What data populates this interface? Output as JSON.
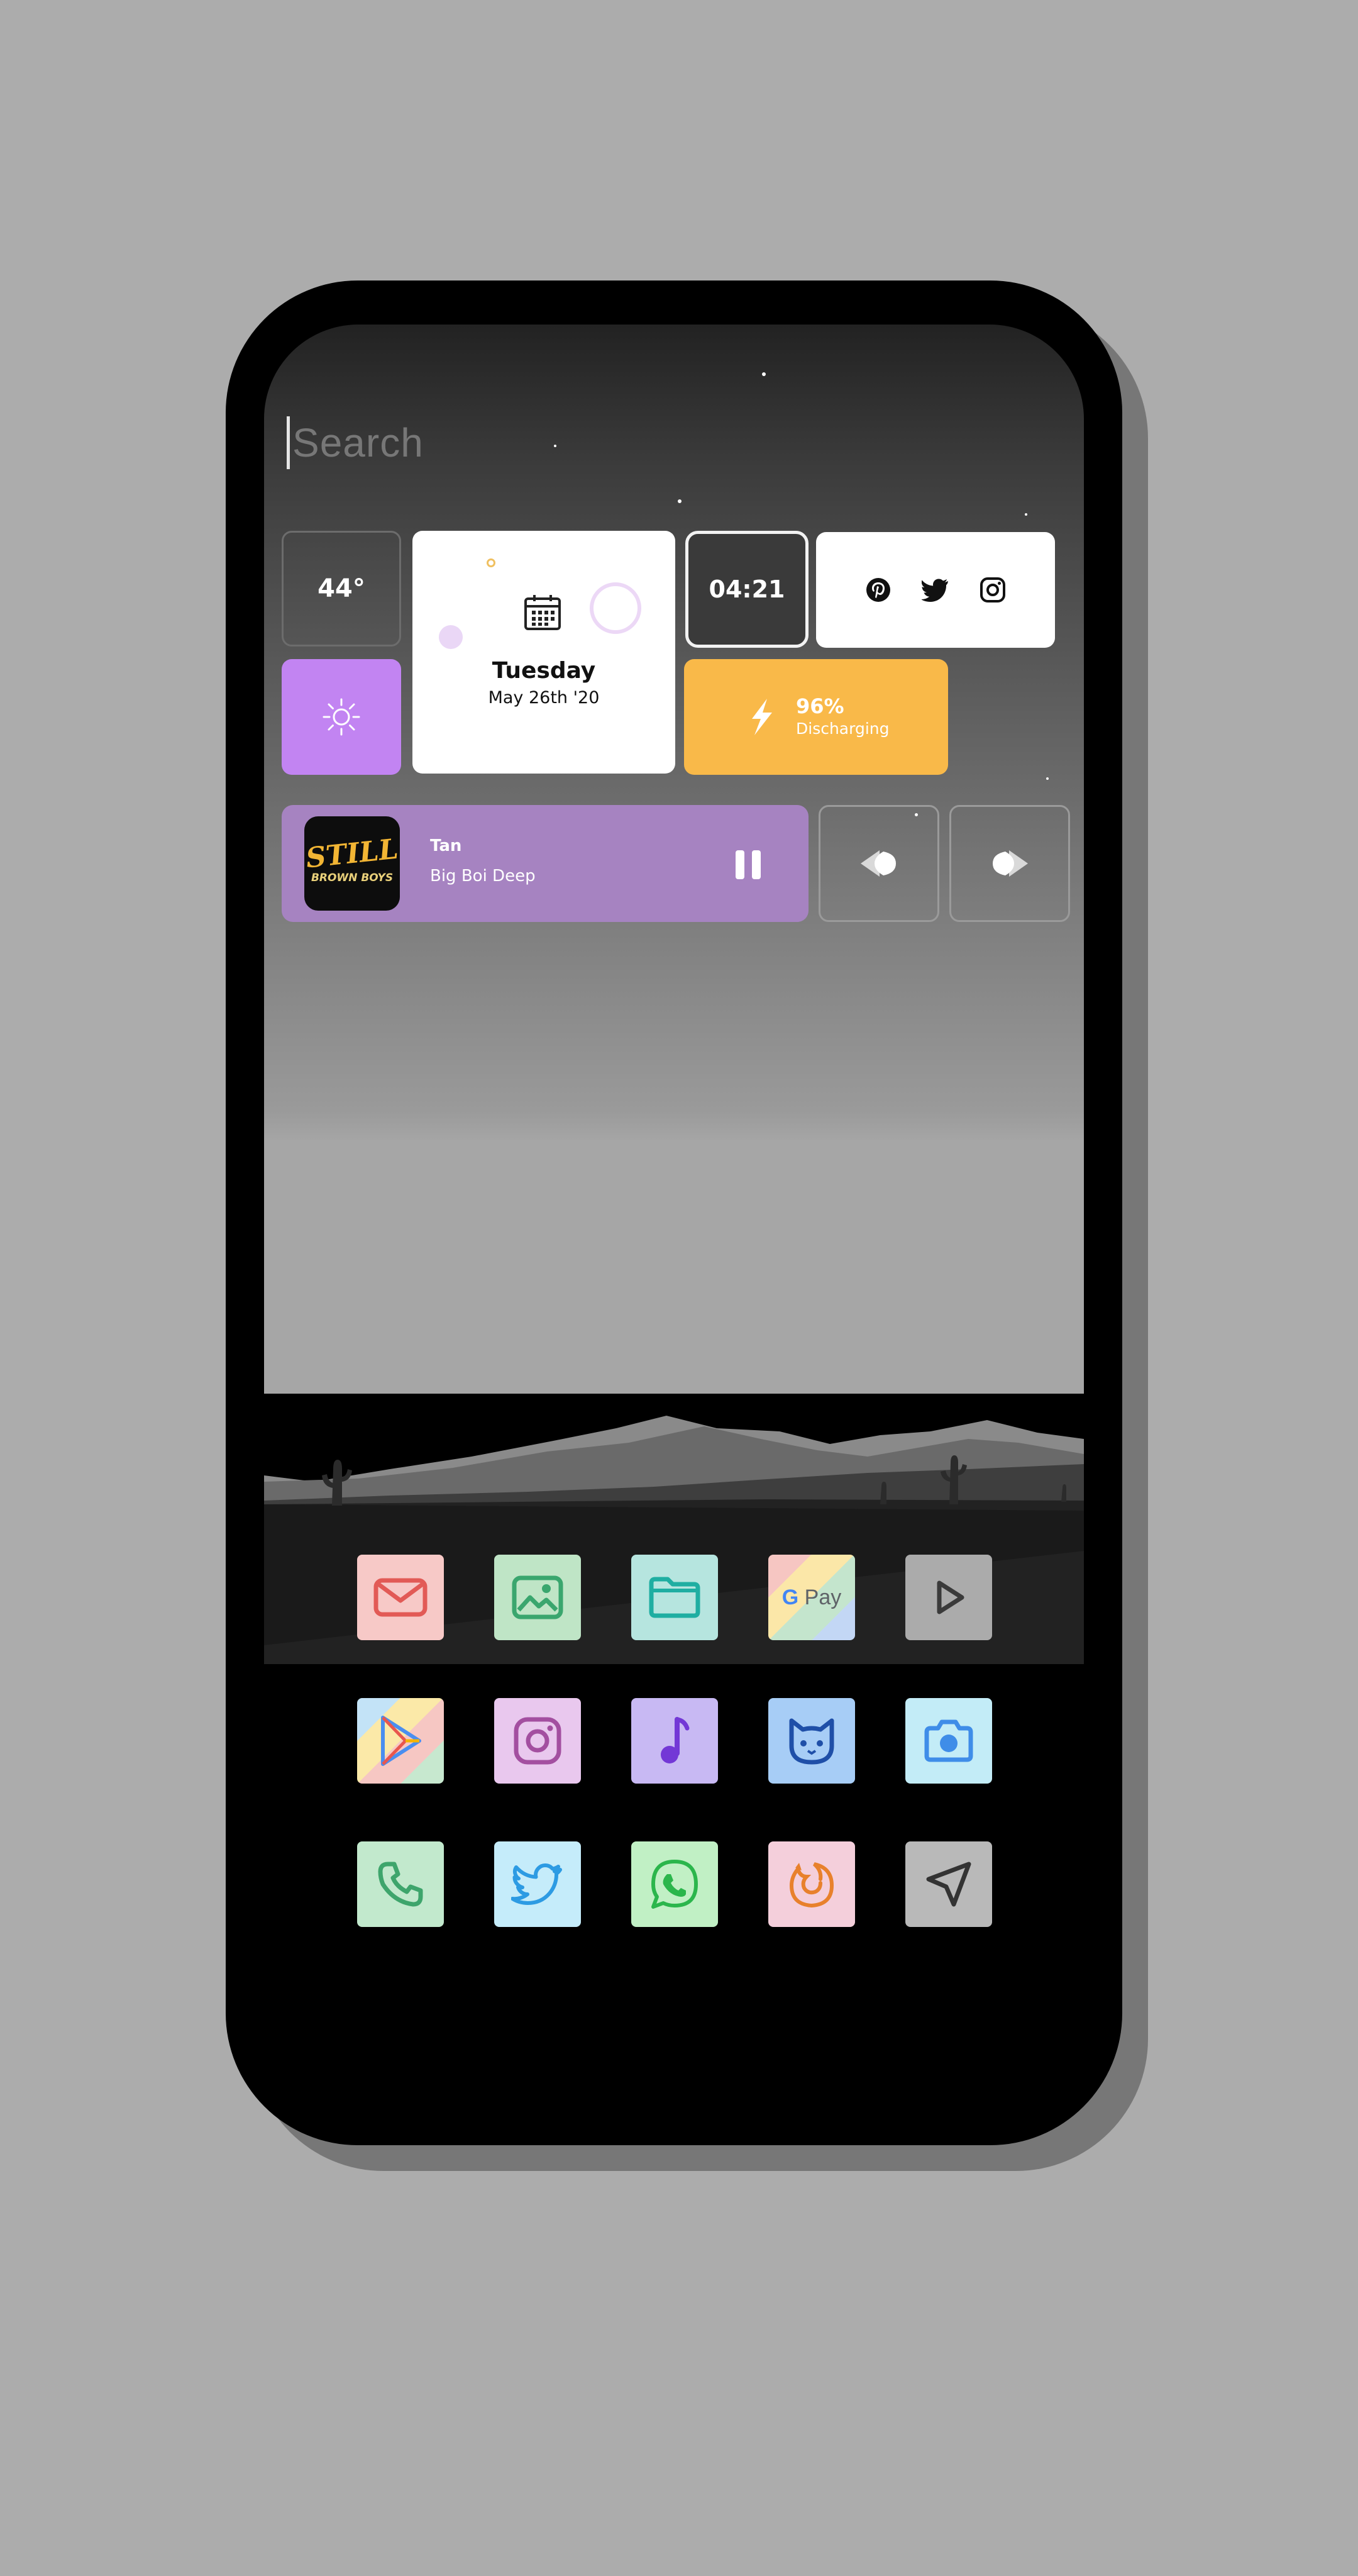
{
  "search": {
    "placeholder": "Search"
  },
  "widgets": {
    "temperature": "44°",
    "weather_condition_icon": "sun-icon",
    "calendar": {
      "day": "Tuesday",
      "date": "May 26th '20"
    },
    "clock": "04:21",
    "social_icons": [
      "pinterest-icon",
      "twitter-icon",
      "instagram-icon"
    ],
    "battery": {
      "percent": "96%",
      "status": "Discharging"
    }
  },
  "music": {
    "title": "Tan",
    "artist": "Big Boi Deep",
    "album_art_text": "STILL",
    "album_art_subtext": "BROWN BOYS"
  },
  "apps": [
    {
      "name": "mail-icon",
      "color": "#f7c9c7"
    },
    {
      "name": "gallery-icon",
      "color": "#bfe5c6"
    },
    {
      "name": "files-icon",
      "color": "#b6e5df"
    },
    {
      "name": "google-pay-icon",
      "label": "G Pay",
      "color": "#e8e8e8"
    },
    {
      "name": "play-icon",
      "color": "#ababab"
    },
    {
      "name": "play-store-icon",
      "color": "#e8e8e8"
    },
    {
      "name": "instagram-icon",
      "color": "#e9c8ee"
    },
    {
      "name": "music-icon",
      "color": "#c8b9f3"
    },
    {
      "name": "cat-app-icon",
      "color": "#a7cdf6"
    },
    {
      "name": "camera-icon",
      "color": "#c3ecf7"
    },
    {
      "name": "phone-icon",
      "color": "#c2e9cd"
    },
    {
      "name": "twitter-icon",
      "color": "#c5ecfa"
    },
    {
      "name": "whatsapp-icon",
      "color": "#c1f0c5"
    },
    {
      "name": "firefox-icon",
      "color": "#f4cfdb"
    },
    {
      "name": "send-icon",
      "color": "#b9b9b9"
    }
  ]
}
